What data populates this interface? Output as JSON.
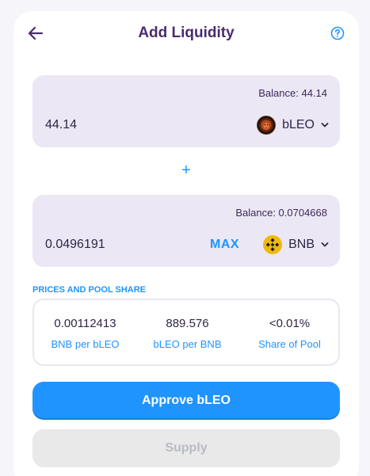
{
  "header": {
    "title": "Add Liquidity"
  },
  "token_a": {
    "balance_label": "Balance: 44.14",
    "amount": "44.14",
    "symbol": "bLEO"
  },
  "token_b": {
    "balance_label": "Balance: 0.0704668",
    "amount": "0.0496191",
    "symbol": "BNB",
    "max_label": "MAX"
  },
  "plus_symbol": "+",
  "prices": {
    "section_label": "PRICES AND POOL SHARE",
    "items": [
      {
        "value": "0.00112413",
        "label": "BNB per bLEO"
      },
      {
        "value": "889.576",
        "label": "bLEO per BNB"
      },
      {
        "value": "<0.01%",
        "label": "Share of Pool"
      }
    ]
  },
  "buttons": {
    "approve_label": "Approve bLEO",
    "supply_label": "Supply"
  },
  "colors": {
    "accent": "#1f94ff",
    "title": "#4a2c6f",
    "panel": "#ebe7f4",
    "disabled_bg": "#e9e9ea",
    "disabled_text": "#b9bcc0"
  },
  "icons": {
    "back": "arrow-left-icon",
    "help": "question-circle-icon",
    "token_a": "bleo-lion-icon",
    "token_b": "bnb-logo-icon",
    "dropdown": "chevron-down-icon"
  }
}
